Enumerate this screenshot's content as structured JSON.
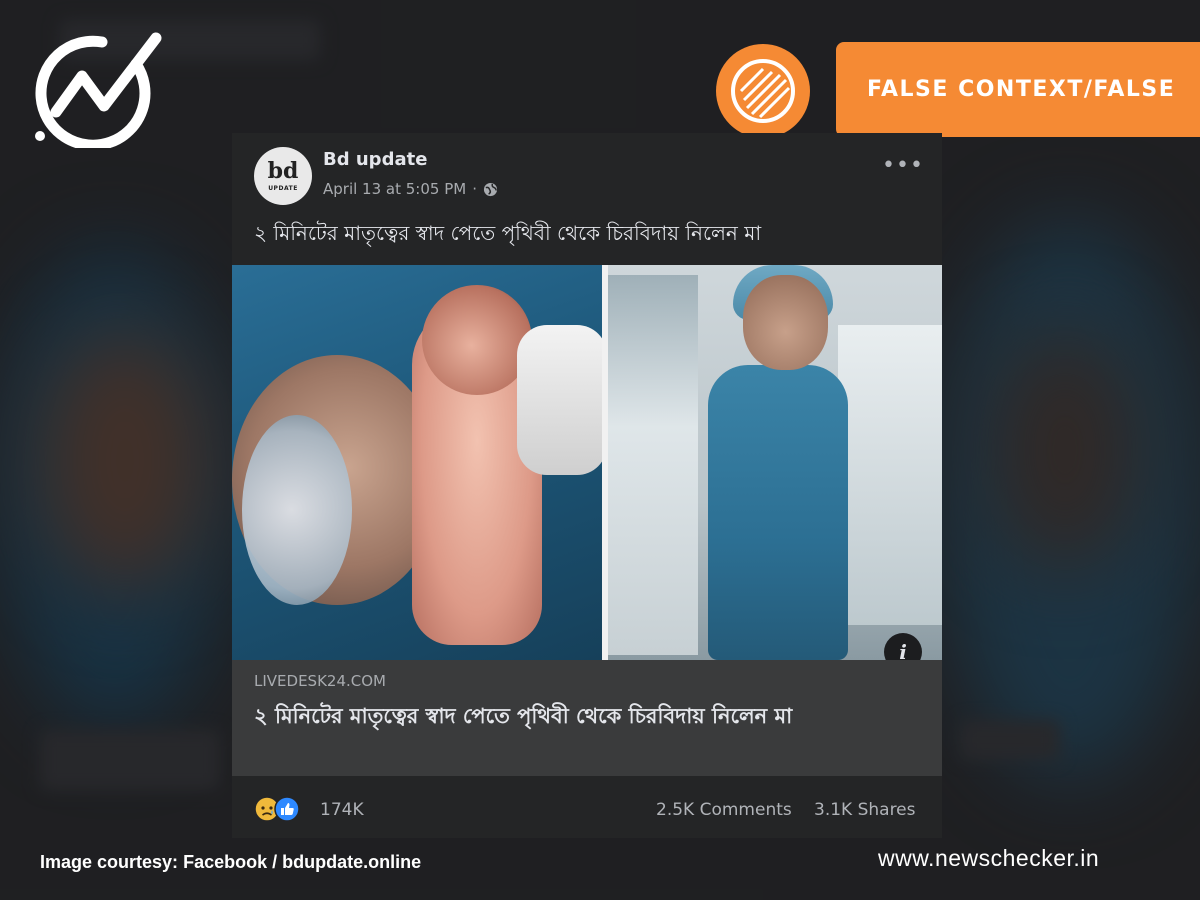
{
  "verdict": {
    "label": "FALSE CONTEXT/FALSE",
    "color": "#f58a34"
  },
  "post": {
    "page_name": "Bd update",
    "avatar_text": "bd",
    "avatar_tag": "UPDATE",
    "timestamp": "April 13 at 5:05 PM",
    "audience_icon": "globe-icon",
    "more_label": "•••",
    "text": "২ মিনিটের মাতৃত্বের স্বাদ পেতে পৃথিবী থেকে চিরবিদায় নিলেন মা",
    "info_label": "i",
    "link": {
      "domain": "LIVEDESK24.COM",
      "title": "২ মিনিটের মাতৃত্বের স্বাদ পেতে পৃথিবী থেকে চিরবিদায় নিলেন মা"
    },
    "reactions": {
      "icons": [
        "sad-reaction-icon",
        "like-reaction-icon"
      ],
      "count": "174K",
      "comments": "2.5K Comments",
      "shares": "3.1K Shares"
    }
  },
  "footer": {
    "credit_label": "Image courtesy:",
    "credit_source": "Facebook / bdupdate.online",
    "website": "www.newschecker.in"
  }
}
